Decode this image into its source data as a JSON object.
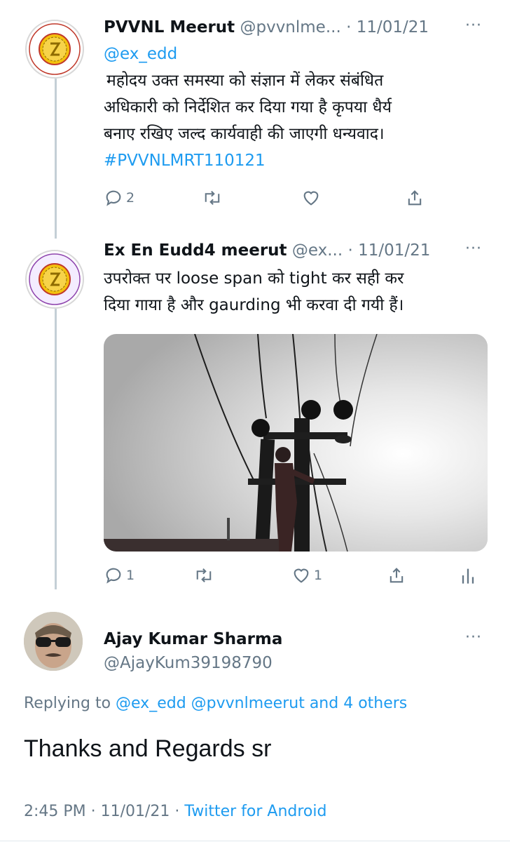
{
  "tweets": [
    {
      "display_name": "PVVNL Meerut",
      "handle": "@pvvnlme...",
      "date": "· 11/01/21",
      "mention": "@ex_edd",
      "lines": [
        "महोदय उक्त समस्या को संज्ञान में लेकर संबंधित",
        "अधिकारी को निर्देशित कर दिया गया है कृपया धैर्य",
        "बनाए रखिए जल्द कार्यवाही की जाएगी धन्यवाद।"
      ],
      "hashtag": "#PVVNLMRT110121",
      "reply_count": "2",
      "like_count": ""
    },
    {
      "display_name": "Ex En Eudd4 meerut",
      "handle": "@ex...",
      "date": "· 11/01/21",
      "lines": [
        "उपरोक्त पर loose span को tight कर सही कर",
        "दिया गाया है और gaurding भी करवा दी गयी हैं।"
      ],
      "reply_count": "1",
      "like_count": "1"
    }
  ],
  "main_tweet": {
    "display_name": "Ajay Kumar Sharma",
    "handle": "@AjayKum39198790",
    "replying_prefix": "Replying to",
    "replying_to": "@ex_edd @pvvnlmeerut and 4 others",
    "text": "Thanks and Regards sr",
    "timestamp": "2:45 PM · 11/01/21 ·",
    "source": "Twitter for Android"
  },
  "icons": {
    "more": "more-dots-icon",
    "reply": "reply-icon",
    "retweet": "retweet-icon",
    "like": "heart-icon",
    "share": "share-icon",
    "analytics": "analytics-icon"
  },
  "colors": {
    "accent": "#1d9bf0",
    "muted": "#657786",
    "text": "#0f1419"
  }
}
